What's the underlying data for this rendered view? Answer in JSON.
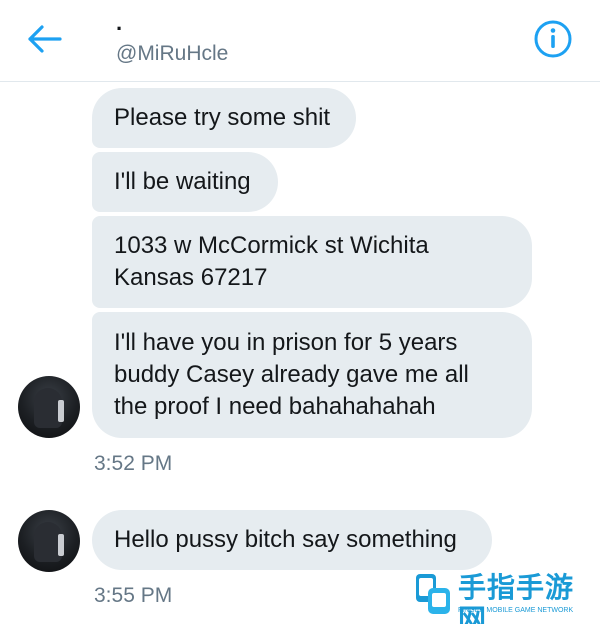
{
  "header": {
    "display_name": "·",
    "handle": "@MiRuHcle"
  },
  "messages": [
    {
      "text": "Please try some shit"
    },
    {
      "text": "I'll be waiting"
    },
    {
      "text": "1033 w McCormick st Wichita\nKansas 67217"
    },
    {
      "text": "I'll have you in prison for 5 years\nbuddy Casey already gave me all\nthe proof I need bahahahahah"
    },
    {
      "text": "Hello pussy bitch say something"
    }
  ],
  "timestamps": [
    "3:52 PM",
    "3:55 PM"
  ],
  "watermark": {
    "title": "手指手游网",
    "subtitle": "FINGER MOBILE GAME NETWORK"
  },
  "colors": {
    "accent": "#1da1f2",
    "bubble": "#e6ecf0",
    "secondary_text": "#657786"
  },
  "icons": {
    "back": "arrow-left-icon",
    "info": "info-circle-icon"
  }
}
